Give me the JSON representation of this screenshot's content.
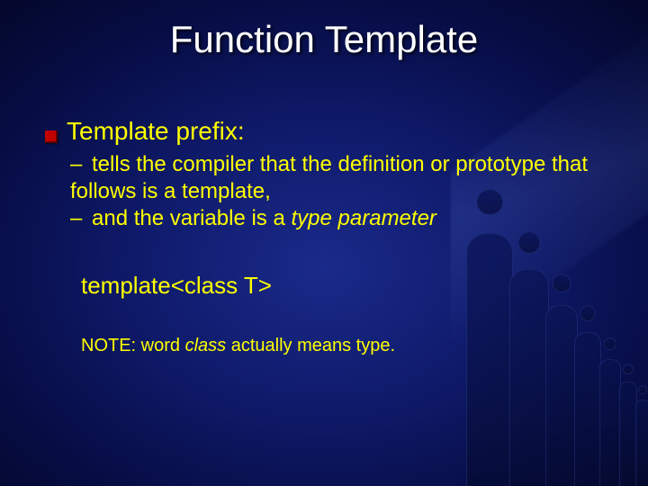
{
  "title": "Function Template",
  "bullet1": "Template prefix:",
  "sub1_prefix": "– ",
  "sub1_text": "tells the compiler that the definition or prototype that follows is a template,",
  "sub2_prefix": "– ",
  "sub2_text_a": "and the variable is a ",
  "sub2_text_b": "type parameter",
  "code": "template<class T>",
  "note_a": "NOTE:  word ",
  "note_b": "class",
  "note_c": " actually means type."
}
